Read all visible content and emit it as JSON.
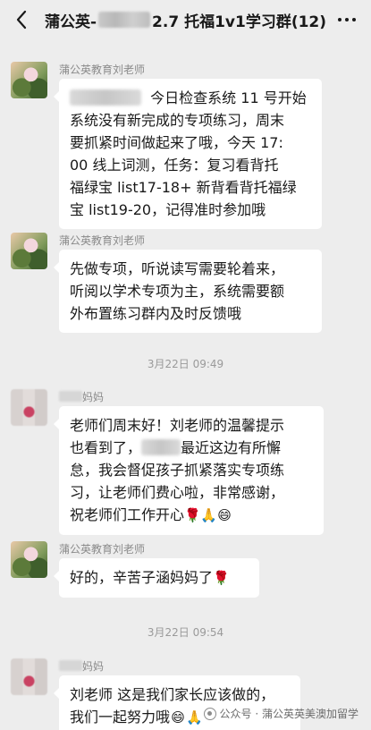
{
  "header": {
    "title_prefix": "蒲公英-",
    "title_suffix": "2.7 托福1v1学习群(12)"
  },
  "messages": [
    {
      "sender": "蒲公英教育刘老师",
      "lines": [
        "今日检查系统 11 号开始",
        "系统没有新完成的专项练习，周末",
        "要抓紧时间做起来了哦，今天 17:",
        "00 线上词测，任务：复习看背托",
        "福绿宝 list17-18+ 新背看背托福绿",
        "宝 list19-20，记得准时参加哦"
      ]
    },
    {
      "sender": "蒲公英教育刘老师",
      "lines": [
        "先做专项，听说读写需要轮着来，",
        "听阅以学术专项为主，系统需要额",
        "外布置练习群内及时反馈哦"
      ]
    },
    {
      "time": "3月22日 09:49"
    },
    {
      "sender_suffix": "妈妈",
      "lines": [
        "老师们周末好！刘老师的温馨提示",
        "也看到了，",
        "最近这边有所懈",
        "怠，我会督促孩子抓紧落实专项练",
        "习，让老师们费心啦，非常感谢，",
        "祝老师们工作开心"
      ],
      "emojis": [
        "🌹",
        "🙏",
        "😄"
      ]
    },
    {
      "sender": "蒲公英教育刘老师",
      "lines": [
        "好的，辛苦子涵妈妈了"
      ],
      "emojis": [
        "🌹"
      ]
    },
    {
      "time": "3月22日 09:54"
    },
    {
      "sender_suffix": "妈妈",
      "lines": [
        "刘老师 这是我们家长应该做的，",
        "我们一起努力哦"
      ],
      "emojis": [
        "😄",
        "🙏"
      ]
    }
  ],
  "watermark": "公众号 · 蒲公英英美澳加留学"
}
